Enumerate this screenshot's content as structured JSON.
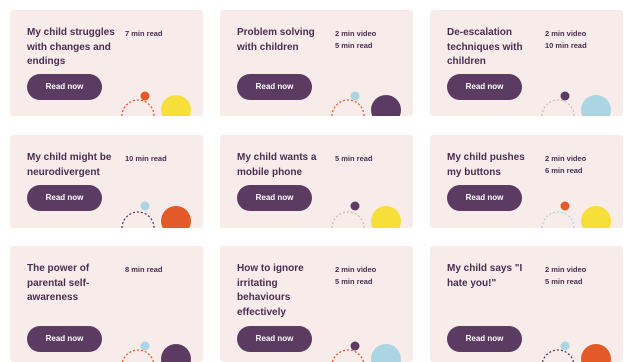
{
  "colors": {
    "card_bg": "#f7ece9",
    "button_bg": "#5b3b62",
    "text": "#4a2d52",
    "yellow": "#f7df3a",
    "orange": "#e35a28",
    "purple": "#5b3b62",
    "light_blue": "#acd5e3"
  },
  "cards": [
    {
      "title": "My child struggles with changes and endings",
      "meta": [
        "7 min read"
      ],
      "button": "Read now",
      "decoration": {
        "small_dot": "orange",
        "big_circle": "yellow",
        "arc": "orange"
      }
    },
    {
      "title": "Problem solving with children",
      "meta": [
        "2 min video",
        "5 min read"
      ],
      "button": "Read now",
      "decoration": {
        "small_dot": "light_blue",
        "big_circle": "purple",
        "arc": "orange"
      }
    },
    {
      "title": "De-escalation techniques with children",
      "meta": [
        "2 min video",
        "10 min read"
      ],
      "button": "Read now",
      "decoration": {
        "small_dot": "purple",
        "big_circle": "light_blue",
        "arc": "grey"
      }
    },
    {
      "title": "My child might be neurodivergent",
      "meta": [
        "10 min read"
      ],
      "button": "Read now",
      "decoration": {
        "small_dot": "light_blue",
        "big_circle": "orange",
        "arc": "purple"
      }
    },
    {
      "title": "My child wants a mobile phone",
      "meta": [
        "5 min read"
      ],
      "button": "Read now",
      "decoration": {
        "small_dot": "purple",
        "big_circle": "yellow",
        "arc": "grey"
      }
    },
    {
      "title": "My child pushes my buttons",
      "meta": [
        "2 min video",
        "6 min read"
      ],
      "button": "Read now",
      "decoration": {
        "small_dot": "orange",
        "big_circle": "yellow",
        "arc": "light_blue"
      }
    },
    {
      "title": "The power of parental self-awareness",
      "meta": [
        "8 min read"
      ],
      "button": "Read now",
      "decoration": {
        "small_dot": "light_blue",
        "big_circle": "purple",
        "arc": "orange"
      }
    },
    {
      "title": "How to ignore irritating behaviours effectively",
      "meta": [
        "2 min video",
        "5 min read"
      ],
      "button": "Read now",
      "decoration": {
        "small_dot": "purple",
        "big_circle": "light_blue",
        "arc": "orange"
      }
    },
    {
      "title": "My child says \"I hate you!\"",
      "meta": [
        "2 min video",
        "5 min read"
      ],
      "button": "Read now",
      "decoration": {
        "small_dot": "light_blue",
        "big_circle": "orange",
        "arc": "purple"
      }
    }
  ]
}
